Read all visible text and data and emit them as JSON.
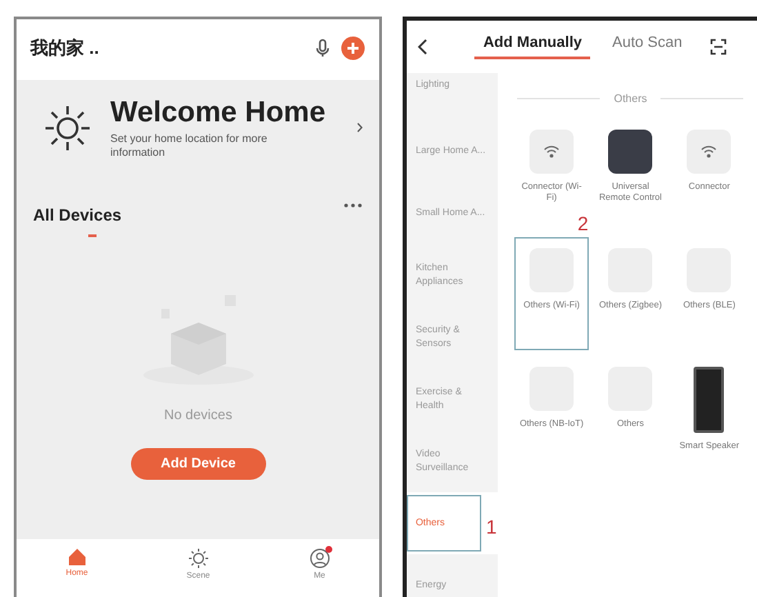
{
  "home_screen": {
    "home_name": "我的家 ..",
    "welcome": {
      "title": "Welcome Home",
      "subtitle": "Set your home location for more information"
    },
    "section_title": "All Devices",
    "empty_text": "No devices",
    "add_button": "Add Device",
    "nav": [
      {
        "label": "Home",
        "kind": "home",
        "selected": true,
        "badge": false
      },
      {
        "label": "Scene",
        "kind": "scene",
        "selected": false,
        "badge": false
      },
      {
        "label": "Me",
        "kind": "me",
        "selected": false,
        "badge": true
      }
    ]
  },
  "add_screen": {
    "tabs": [
      {
        "label": "Add Manually",
        "selected": true
      },
      {
        "label": "Auto Scan",
        "selected": false
      }
    ],
    "categories": [
      {
        "label": "Lighting",
        "selected": false
      },
      {
        "label": "Large Home A...",
        "selected": false
      },
      {
        "label": "Small Home A...",
        "selected": false
      },
      {
        "label": "Kitchen Appliances",
        "selected": false
      },
      {
        "label": "Security & Sensors",
        "selected": false
      },
      {
        "label": "Exercise & Health",
        "selected": false
      },
      {
        "label": "Video Surveillance",
        "selected": false
      },
      {
        "label": "Others",
        "selected": true,
        "annotation": "1"
      },
      {
        "label": "Energy",
        "selected": false
      }
    ],
    "group_title": "Others",
    "devices": [
      {
        "label": "Connector (Wi-Fi)",
        "kind": "wifi"
      },
      {
        "label": "Universal Remote Control",
        "kind": "remote"
      },
      {
        "label": "Connector",
        "kind": "wifi"
      },
      {
        "label": "Others (Wi-Fi)",
        "kind": "plain",
        "annotation": "2"
      },
      {
        "label": "Others (Zigbee)",
        "kind": "plain"
      },
      {
        "label": "Others (BLE)",
        "kind": "plain"
      },
      {
        "label": "Others (NB-IoT)",
        "kind": "plain"
      },
      {
        "label": "Others",
        "kind": "plain"
      },
      {
        "label": "Smart Speaker",
        "kind": "speaker"
      }
    ]
  }
}
